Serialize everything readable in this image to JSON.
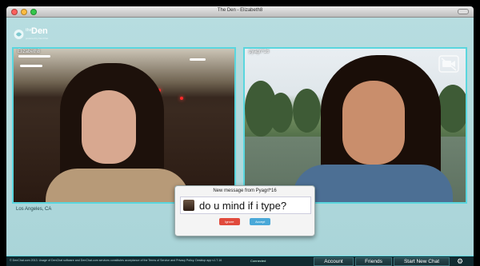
{
  "window": {
    "title": "The Den - Elizabeth8"
  },
  "brand": {
    "the": "the",
    "den": "Den",
    "tagline": "powered by DenChat"
  },
  "left_video": {
    "username": "Elizabeth8",
    "location": "Los Angeles, CA"
  },
  "right_video": {
    "username": "pyagrl*16",
    "camera_icon": "camera-off-icon"
  },
  "popup": {
    "title": "New message from Pyagrl*16",
    "message": "do u mind if i type?",
    "ignore_label": "Ignore",
    "accept_label": "Accept"
  },
  "bottom": {
    "legal": "© DenChat.com 2013. Usage of DenChat software and DenChat.com services constitutes acceptance of the Terms of Service and Privacy Policy.  Desktop app v1.7.16",
    "status": "Connected",
    "account": "Account",
    "friends": "Friends",
    "new_chat": "Start New Chat"
  },
  "colors": {
    "accent": "#5ad6de",
    "app_bg": "#b7dde0",
    "bar": "#112a30",
    "ignore": "#e14a3c",
    "accept": "#4aa8d8"
  }
}
